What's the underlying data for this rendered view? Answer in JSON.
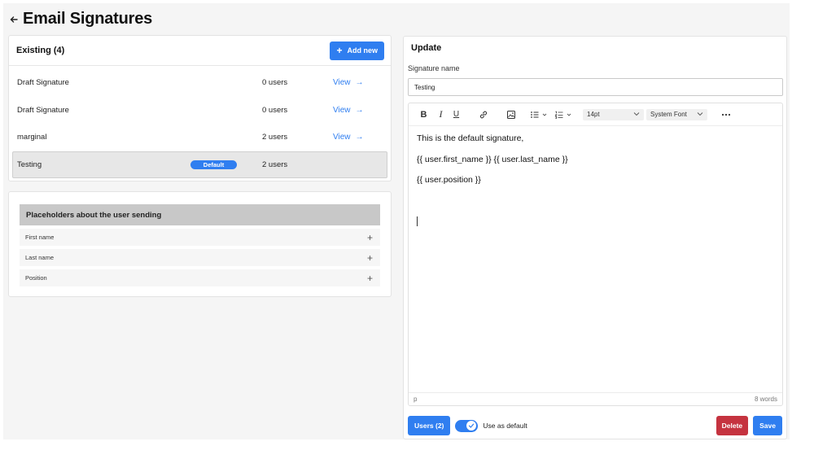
{
  "page": {
    "title": "Email Signatures",
    "back_icon": "arrow-left-icon"
  },
  "existing": {
    "title": "Existing (4)",
    "add_new_label": "Add new",
    "signatures": [
      {
        "name": "Draft Signature",
        "badge": "",
        "users": "0 users",
        "view": "View"
      },
      {
        "name": "Draft Signature",
        "badge": "",
        "users": "0 users",
        "view": "View"
      },
      {
        "name": "marginal",
        "badge": "",
        "users": "2 users",
        "view": "View"
      },
      {
        "name": "Testing",
        "badge": "Default",
        "users": "2 users",
        "view": ""
      }
    ]
  },
  "placeholders": {
    "title": "Placeholders about the user sending",
    "items": [
      {
        "label": "First name"
      },
      {
        "label": "Last name"
      },
      {
        "label": "Position"
      }
    ]
  },
  "update": {
    "title": "Update",
    "name_label": "Signature name",
    "name_value": "Testing",
    "toolbar": {
      "font_size": "14pt",
      "font_family": "System Font"
    },
    "content": [
      "This is the default signature,",
      "{{ user.first_name }} {{ user.last_name }}",
      "{{ user.position }}"
    ],
    "status_path": "p",
    "word_count": "8 words",
    "users_button": "Users (2)",
    "use_as_default_label": "Use as default",
    "use_as_default": true,
    "delete_label": "Delete",
    "save_label": "Save"
  },
  "colors": {
    "accent": "#2f7ef0",
    "danger": "#c5333f"
  }
}
